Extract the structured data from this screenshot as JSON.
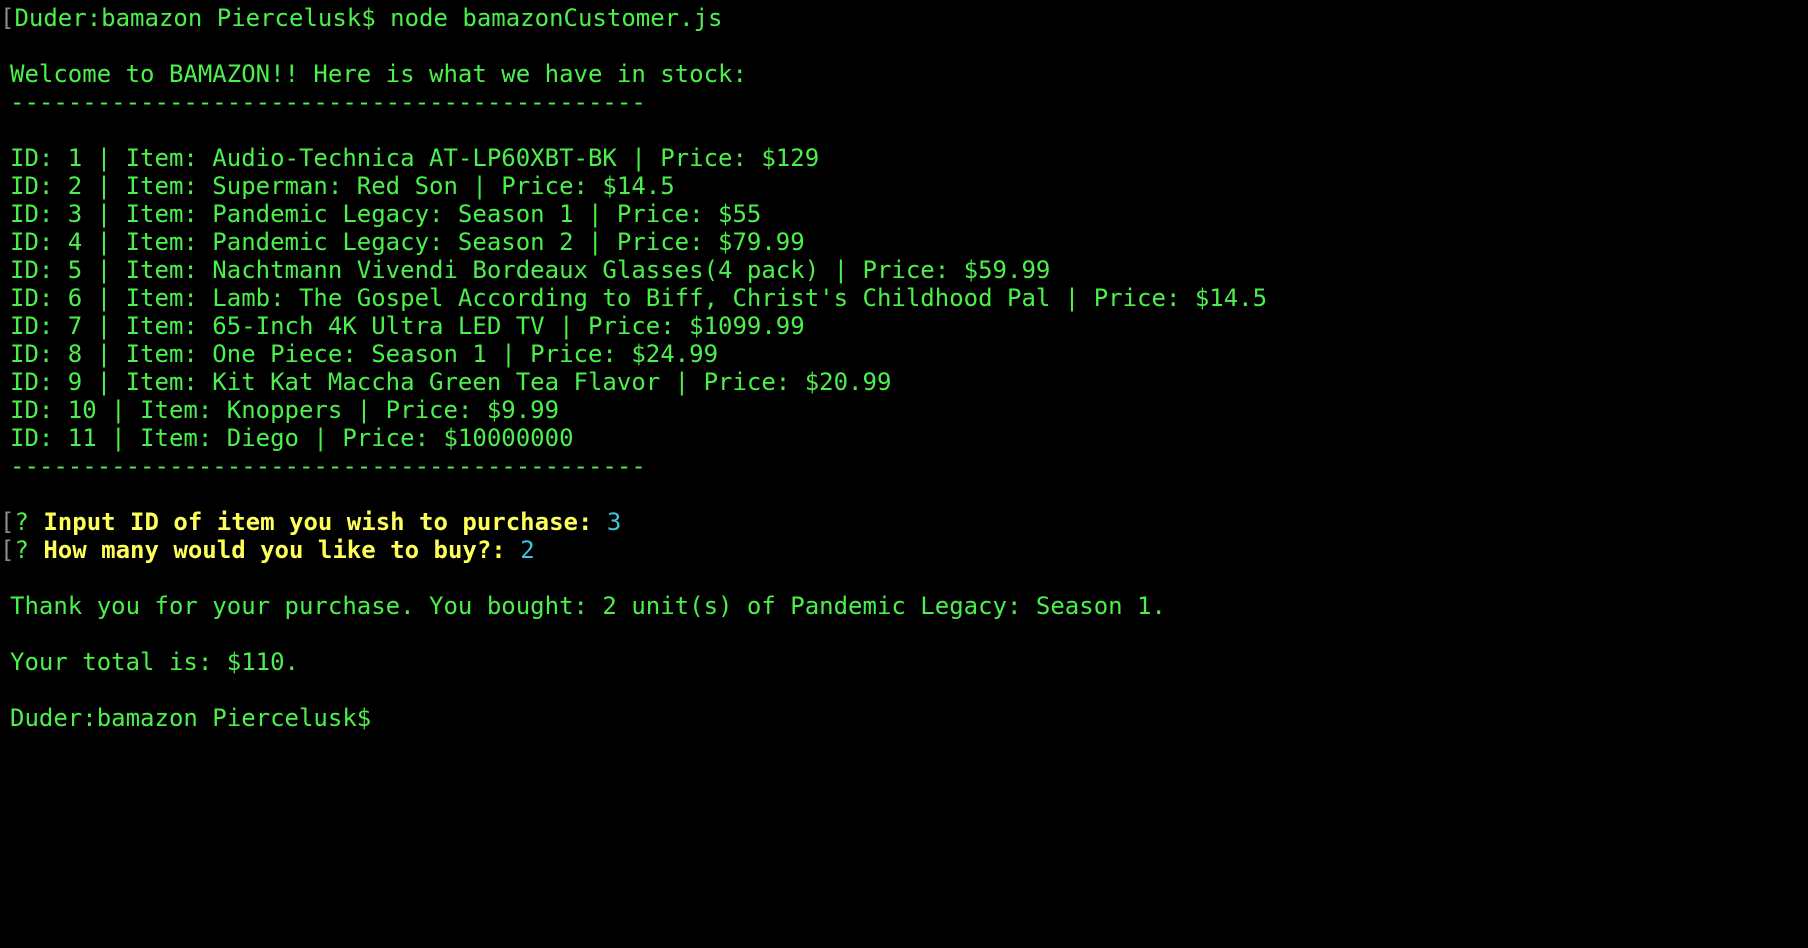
{
  "terminal": {
    "command_prompt": "Duder:bamazon Piercelusk$",
    "command": "node bamazonCustomer.js",
    "welcome": "Welcome to BAMAZON!! Here is what we have in stock:",
    "divider": "--------------------------------------------",
    "items": [
      "ID: 1 | Item: Audio-Technica AT-LP60XBT-BK | Price: $129",
      "ID: 2 | Item: Superman: Red Son | Price: $14.5",
      "ID: 3 | Item: Pandemic Legacy: Season 1 | Price: $55",
      "ID: 4 | Item: Pandemic Legacy: Season 2 | Price: $79.99",
      "ID: 5 | Item: Nachtmann Vivendi Bordeaux Glasses(4 pack) | Price: $59.99",
      "ID: 6 | Item: Lamb: The Gospel According to Biff, Christ's Childhood Pal | Price: $14.5",
      "ID: 7 | Item: 65-Inch 4K Ultra LED TV | Price: $1099.99",
      "ID: 8 | Item: One Piece: Season 1 | Price: $24.99",
      "ID: 9 | Item: Kit Kat Maccha Green Tea Flavor | Price: $20.99",
      "ID: 10 | Item: Knoppers | Price: $9.99",
      "ID: 11 | Item: Diego | Price: $10000000"
    ],
    "question_mark": "?",
    "q1_text": "Input ID of item you wish to purchase:",
    "q1_answer": "3",
    "q2_text": "How many would you like to buy?:",
    "q2_answer": "2",
    "thank_you": "Thank you for your purchase. You bought: 2 unit(s) of Pandemic Legacy: Season 1.",
    "total": "Your total is: $110.",
    "final_prompt": "Duder:bamazon Piercelusk$"
  }
}
